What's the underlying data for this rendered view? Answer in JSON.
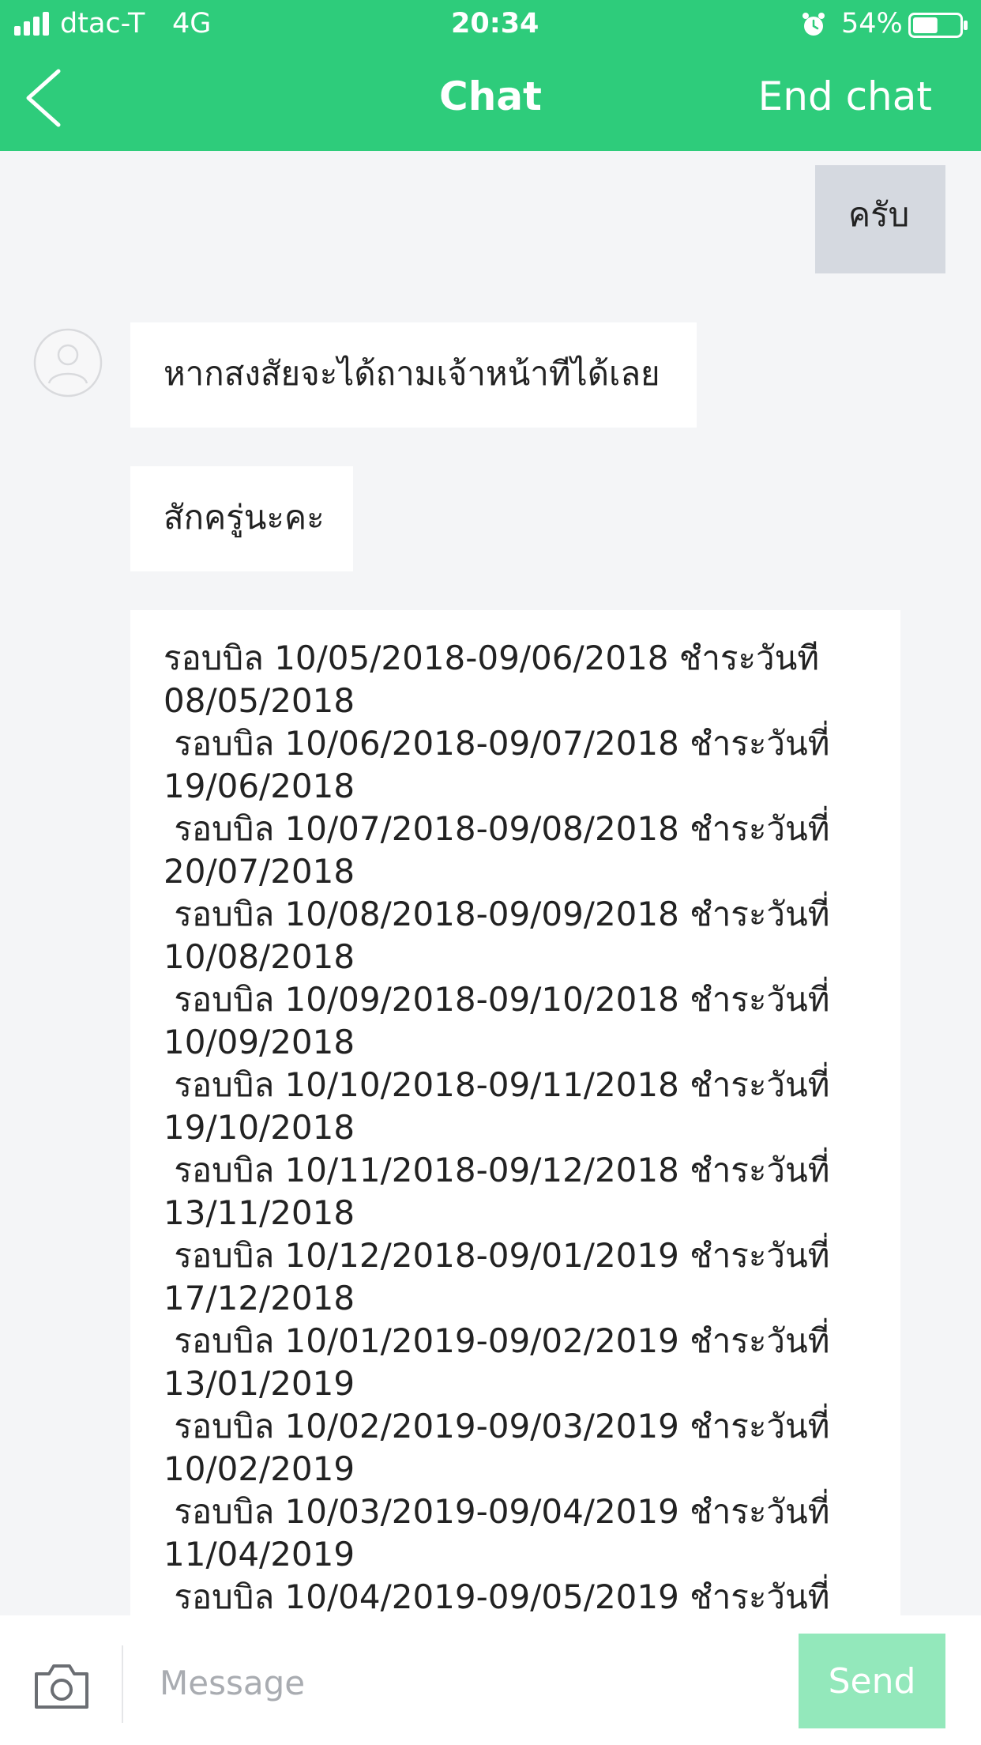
{
  "status_bar": {
    "carrier": "dtac-T",
    "network": "4G",
    "time": "20:34",
    "battery": "54%",
    "battery_level": 0.54,
    "signal_bars": 4,
    "icons": [
      "signal-icon",
      "alarm-icon",
      "battery-icon"
    ]
  },
  "header": {
    "back_icon": "chevron-left-icon",
    "title": "Chat",
    "end_chat_label": "End chat"
  },
  "colors": {
    "header": "#2ecc7b",
    "background": "#f4f5f7",
    "agent_bubble": "#ffffff",
    "user_bubble": "#d5d9e0",
    "send_button_disabled": "#93e8bb",
    "placeholder": "#a9acb1"
  },
  "messages": {
    "user_1": "ครับ",
    "agent_1": "หากสงสัยจะได้ถามเจ้าหน้าทีได้เลย",
    "agent_2": "สักครู่นะคะ",
    "agent_3_lines": [
      "รอบบิล 10/05/2018-09/06/2018 ชำระวันที",
      "08/05/2018",
      " รอบบิล 10/06/2018-09/07/2018 ชำระวันที่",
      "19/06/2018",
      " รอบบิล 10/07/2018-09/08/2018 ชำระวันที่",
      "20/07/2018",
      " รอบบิล 10/08/2018-09/09/2018 ชำระวันที่",
      "10/08/2018",
      " รอบบิล 10/09/2018-09/10/2018 ชำระวันที่",
      "10/09/2018",
      " รอบบิล 10/10/2018-09/11/2018 ชำระวันที่",
      "19/10/2018",
      " รอบบิล 10/11/2018-09/12/2018 ชำระวันที่",
      "13/11/2018",
      " รอบบิล 10/12/2018-09/01/2019 ชำระวันที่",
      "17/12/2018",
      " รอบบิล 10/01/2019-09/02/2019 ชำระวันที่",
      "13/01/2019",
      " รอบบิล 10/02/2019-09/03/2019 ชำระวันที่",
      "10/02/2019",
      " รอบบิล 10/03/2019-09/04/2019 ชำระวันที่",
      "11/04/2019",
      " รอบบิล 10/04/2019-09/05/2019 ชำระวันที่"
    ]
  },
  "input_bar": {
    "camera_icon": "camera-icon",
    "placeholder": "Message",
    "value": "",
    "send_label": "Send",
    "send_enabled": false
  }
}
